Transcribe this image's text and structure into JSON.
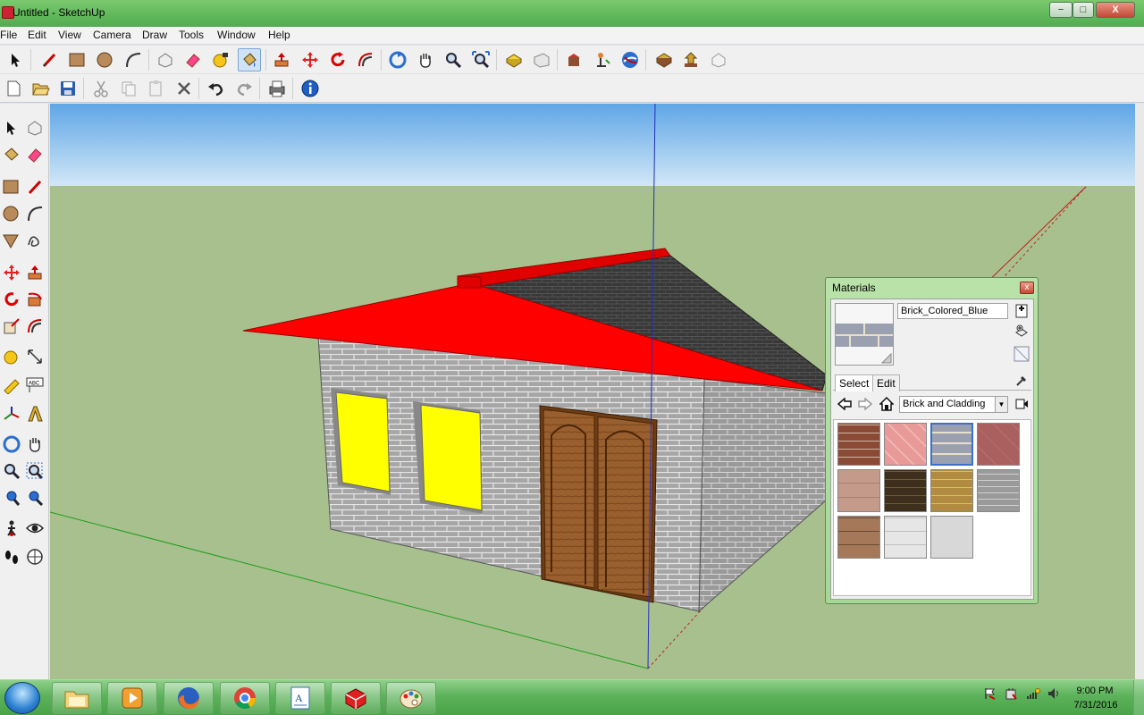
{
  "window": {
    "title": "Untitled - SketchUp",
    "minimize": "−",
    "maximize": "□",
    "close": "X"
  },
  "menu": [
    "File",
    "Edit",
    "View",
    "Camera",
    "Draw",
    "Tools",
    "Window",
    "Help"
  ],
  "toolbar1_icons": [
    "select-icon",
    "line-icon",
    "rectangle-icon",
    "circle-icon",
    "arc-icon",
    "make-component-icon",
    "eraser-icon",
    "tape-measure-icon",
    "paint-bucket-icon",
    "push-pull-icon",
    "move-icon",
    "rotate-icon",
    "offset-icon",
    "orbit-icon",
    "pan-icon",
    "zoom-icon",
    "zoom-extents-icon",
    "warehouse-get-icon",
    "warehouse-share-icon",
    "share-component-icon",
    "position-camera-icon",
    "walk-icon",
    "google-earth-icon",
    "extension-warehouse-icon",
    "send-to-layout-icon",
    "preview-icon"
  ],
  "toolbar2_icons": [
    "new-icon",
    "open-icon",
    "save-icon",
    "cut-icon",
    "copy-icon",
    "paste-icon",
    "delete-icon",
    "undo-icon",
    "redo-icon",
    "print-icon",
    "model-info-icon"
  ],
  "left_tools": [
    "select-icon",
    "make-component-icon",
    "paint-bucket-icon",
    "eraser-icon",
    "rectangle-icon",
    "line-icon",
    "circle-icon",
    "arc-icon",
    "polygon-icon",
    "freehand-icon",
    "move-icon",
    "push-pull-icon",
    "rotate-icon",
    "follow-me-icon",
    "scale-icon",
    "offset-icon",
    "tape-measure-icon",
    "dimension-icon",
    "protractor-icon",
    "text-icon",
    "axes-icon",
    "3d-text-icon",
    "orbit-icon",
    "pan-icon",
    "zoom-icon",
    "zoom-window-icon",
    "previous-view-icon",
    "zoom-extents-icon",
    "walk-icon",
    "look-around-icon",
    "footprints-icon",
    "section-plane-icon"
  ],
  "materials": {
    "title": "Materials",
    "close": "x",
    "material_name": "Brick_Colored_Blue",
    "tabs": [
      "Select",
      "Edit"
    ],
    "collection": "Brick and Cladding",
    "swatch_colors": [
      "#8a4a35",
      "#e89a98",
      "#9aa0b0",
      "#a9605e",
      "#c49a8a",
      "#3e2e1c",
      "#b08b40",
      "#9a9a9a",
      "#a5785a",
      "#dedede",
      "#d8d8d8"
    ]
  },
  "scene": {
    "sky_color": "#a8d0f0",
    "ground_color": "#a9c08f",
    "wall_color": "#a8a8a8",
    "roof_front_color": "#ff0000",
    "roof_back_color": "#3a3a3a",
    "window_color": "#ffff00",
    "door_color": "#9a5f2e"
  },
  "taskbar": {
    "apps": [
      "explorer-icon",
      "media-player-icon",
      "firefox-icon",
      "chrome-icon",
      "text-editor-icon",
      "sketchup-icon",
      "paint-icon"
    ],
    "time": "9:00 PM",
    "date": "7/31/2016"
  }
}
